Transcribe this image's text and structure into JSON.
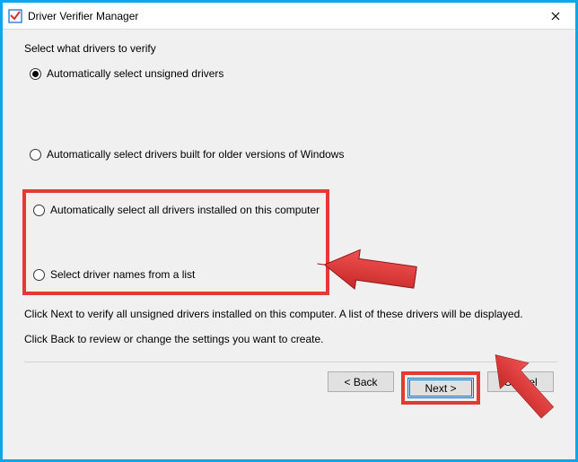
{
  "window": {
    "title": "Driver Verifier Manager"
  },
  "group": {
    "label": "Select what drivers to verify"
  },
  "options": {
    "opt0": {
      "label": "Automatically select unsigned drivers",
      "selected": true
    },
    "opt1": {
      "label": "Automatically select drivers built for older versions of Windows",
      "selected": false
    },
    "opt2": {
      "label": "Automatically select all drivers installed on this computer",
      "selected": false
    },
    "opt3": {
      "label": "Select driver names from a list",
      "selected": false
    }
  },
  "info": {
    "line1": "Click Next to verify all unsigned drivers installed on this computer. A list of these drivers will be displayed.",
    "line2": "Click Back to review or change the settings you want to create."
  },
  "buttons": {
    "back": "< Back",
    "next": "Next >",
    "cancel": "Cancel"
  },
  "annotations": {
    "highlight_box": "highlighted-options",
    "arrow_color": "#e53935"
  }
}
